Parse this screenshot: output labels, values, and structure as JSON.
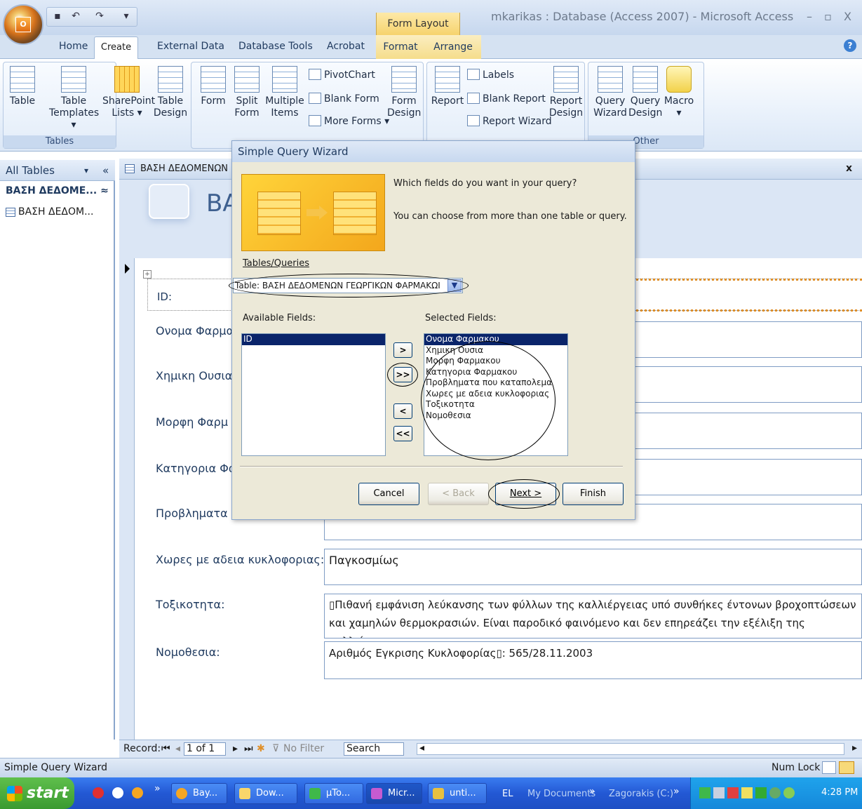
{
  "window": {
    "title": "mkarikas : Database (Access 2007) - Microsoft Access",
    "context_tab": "Form Layout Tools",
    "minimize": "–",
    "maximize": "▫",
    "close": "X"
  },
  "tabs": [
    "Home",
    "Create",
    "External Data",
    "Database Tools",
    "Acrobat",
    "Format",
    "Arrange"
  ],
  "ribbon": {
    "tables_group": "Tables",
    "other_group": "Other",
    "table": "Table",
    "table_templates_1": "Table",
    "table_templates_2": "Templates ▾",
    "sharepoint_1": "SharePoint",
    "sharepoint_2": "Lists ▾",
    "table_design_1": "Table",
    "table_design_2": "Design",
    "form": "Form",
    "split_form_1": "Split",
    "split_form_2": "Form",
    "multiple_items_1": "Multiple",
    "multiple_items_2": "Items",
    "pivotchart": "PivotChart",
    "blank_form": "Blank Form",
    "more_forms": "More Forms ▾",
    "form_design_1": "Form",
    "form_design_2": "Design",
    "report": "Report",
    "labels": "Labels",
    "blank_report": "Blank Report",
    "report_wizard": "Report Wizard",
    "report_design_1": "Report",
    "report_design_2": "Design",
    "query_wizard_1": "Query",
    "query_wizard_2": "Wizard",
    "query_design_1": "Query",
    "query_design_2": "Design",
    "macro": "Macro",
    "macro_arrow": "▾"
  },
  "nav": {
    "header": "All Tables",
    "group": "ΒΑΣΗ ΔΕΔΟΜΕ... ≈",
    "item": "ΒΑΣΗ ΔΕΔΟΜ..."
  },
  "document": {
    "tab_title": "ΒΑΣΗ ΔΕΔΟΜΕΝΩΝ",
    "close": "x",
    "form_title": "ΒΑ",
    "fields": [
      {
        "label": "ID:",
        "value": ""
      },
      {
        "label": "Ονομα Φαρμα",
        "value": ""
      },
      {
        "label": "Χημικη Ουσια:",
        "value": ""
      },
      {
        "label": "Μορφη Φαρμ",
        "value": ""
      },
      {
        "label": "Κατηγορια Φα",
        "value": ""
      },
      {
        "label": "Προβληματα π",
        "value": ""
      },
      {
        "label": "Χωρες με αδεια κυκλοφοριας:",
        "value": "Παγκοσμίως"
      },
      {
        "label": "Τοξικοτητα:",
        "value": "▯Πιθανή εμφάνιση λεύκανσης των φύλλων της καλλιέργειας υπό συνθήκες έντονων βροχοπτώσεων και χαμηλών θερμοκρασιών. Είναι παροδικό φαινόμενο και δεν επηρεάζει την εξέλιξη της καλλιέργειας"
      },
      {
        "label": "Νομοθεσια:",
        "value": "Αριθμός Εγκρισης Κυκλοφορίας▯: 565/28.11.2003"
      }
    ]
  },
  "record_nav": {
    "label": "Record:",
    "position": "1 of 1",
    "filter": "No Filter",
    "search": "Search"
  },
  "status": {
    "left": "Simple Query Wizard",
    "num_lock": "Num Lock"
  },
  "dialog": {
    "title": "Simple Query Wizard",
    "question": "Which fields do you want in your query?",
    "note": "You can choose from more than one table or query.",
    "tables_label": "Tables/Queries",
    "combo_value": "Table: ΒΑΣΗ ΔΕΔΟΜΕΝΩΝ ΓΕΩΡΓΙΚΩΝ ΦΑΡΜΑΚΩΙ",
    "available_label": "Available Fields:",
    "selected_label": "Selected Fields:",
    "available_fields": [
      "ID"
    ],
    "selected_fields": [
      "Ονομα Φαρμακου",
      "Χημικη Ουσια",
      "Μορφη Φαρμακου",
      "Κατηγορια Φαρμακου",
      "Προβληματα που καταπολεμα",
      "Χωρες με αδεια κυκλοφοριας",
      "Τοξικοτητα",
      "Νομοθεσια"
    ],
    "btn_add": ">",
    "btn_add_all": ">>",
    "btn_remove": "<",
    "btn_remove_all": "<<",
    "cancel": "Cancel",
    "back": "< Back",
    "next": "Next >",
    "finish": "Finish"
  },
  "taskbar": {
    "start": "start",
    "items": [
      "Bay...",
      "Dow...",
      "μTo...",
      "Micr...",
      "unti..."
    ],
    "lang": "EL",
    "my_documents": "My Documents",
    "drive": "Zagorakis (C:)",
    "clock": "4:28 PM"
  }
}
